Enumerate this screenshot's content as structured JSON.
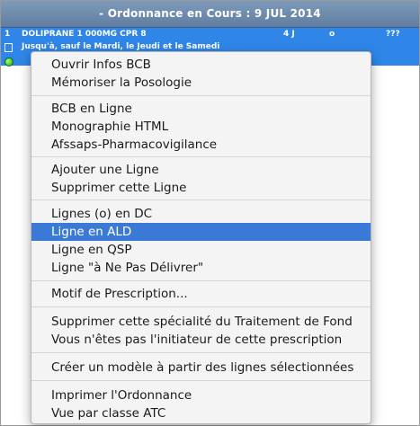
{
  "header": {
    "title": "- Ordonnance en Cours : 9 JUL 2014"
  },
  "prescription_row": {
    "number": "1",
    "drug": "DOLIPRANE 1 000MG CPR 8",
    "duration": "4 J",
    "status": "o",
    "qsp": "???",
    "detail": "Jusqu'à, sauf le Mardi, le Jeudi et le Samedi"
  },
  "context_menu": {
    "items": [
      "Ouvrir Infos BCB",
      "Mémoriser la Posologie",
      "BCB en Ligne",
      "Monographie HTML",
      "Afssaps-Pharmacovigilance",
      "Ajouter une Ligne",
      "Supprimer cette Ligne",
      "Lignes (o) en DC",
      "Ligne en ALD",
      "Ligne en QSP",
      "Ligne \"à Ne Pas Délivrer\"",
      "Motif de Prescription...",
      "Supprimer cette spécialité du Traitement de Fond",
      "Vous n'êtes pas l'initiateur de cette prescription",
      "Créer un modèle à partir des lignes sélectionnées",
      "Imprimer l'Ordonnance",
      "Vue par classe ATC"
    ],
    "highlighted_item": "Ligne en ALD"
  },
  "colors": {
    "title_bar": "#6f8bae",
    "selection": "#2f86e8",
    "menu_highlight": "#3a79d6",
    "status_dot": "#18a21a"
  }
}
